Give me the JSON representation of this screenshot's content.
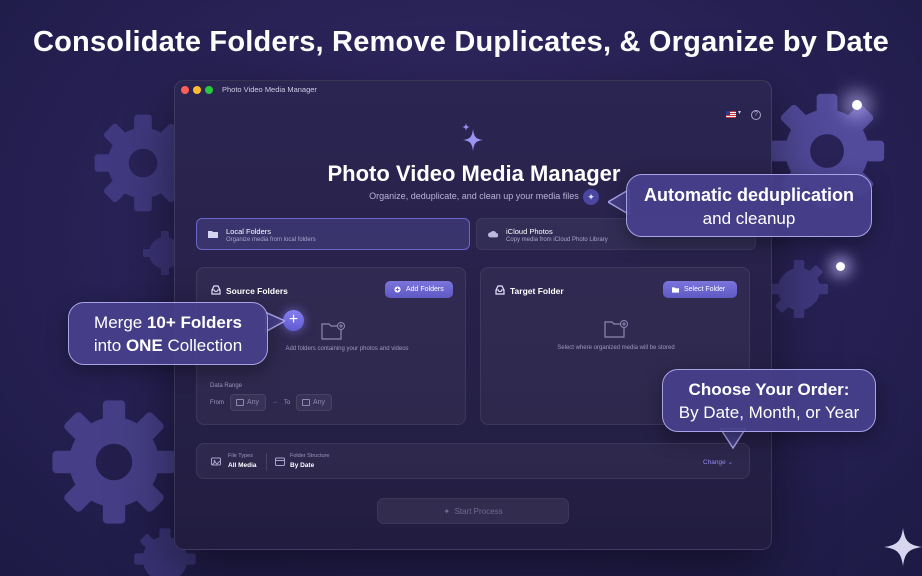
{
  "headline": "Consolidate Folders, Remove Duplicates, & Organize by Date",
  "window": {
    "title": "Photo Video Media Manager",
    "language_icon": "us-flag-icon",
    "help_icon": "question-mark-icon"
  },
  "app": {
    "title": "Photo Video Media Manager",
    "subtitle": "Organize, deduplicate, and clean up your media files"
  },
  "source_tabs": [
    {
      "label": "Local Folders",
      "description": "Organize media from local folders",
      "icon": "folder-icon",
      "selected": true
    },
    {
      "label": "iCloud Photos",
      "description": "Copy media from iCloud Photo Library",
      "icon": "cloud-icon",
      "selected": false
    }
  ],
  "source_panel": {
    "title": "Source Folders",
    "add_button": "Add Folders",
    "placeholder": "Add folders containing your photos and videos",
    "date_range_label": "Data Range",
    "from_label": "From",
    "to_label": "To",
    "from_value": "Any",
    "to_value": "Any"
  },
  "target_panel": {
    "title": "Target Folder",
    "select_button": "Select Folder",
    "placeholder": "Select where organized media will be stored"
  },
  "settings_bar": {
    "file_types_label": "File Types",
    "file_types_value": "All Media",
    "folder_structure_label": "Folder Structure",
    "folder_structure_value": "By Date",
    "change_label": "Change"
  },
  "start_button": "Start Process",
  "callouts": {
    "dedup": {
      "line1": "Automatic deduplication",
      "line2": "and cleanup"
    },
    "merge": {
      "pre": "Merge ",
      "bold1": "10+ Folders",
      "line2_pre": "into ",
      "bold2": "ONE",
      "line2_post": " Collection"
    },
    "order": {
      "line1": "Choose Your Order:",
      "line2": "By Date, Month, or Year"
    }
  },
  "colors": {
    "accent": "#6a64d8",
    "background": "#2a2358",
    "callout_border": "#a8a2e6"
  }
}
